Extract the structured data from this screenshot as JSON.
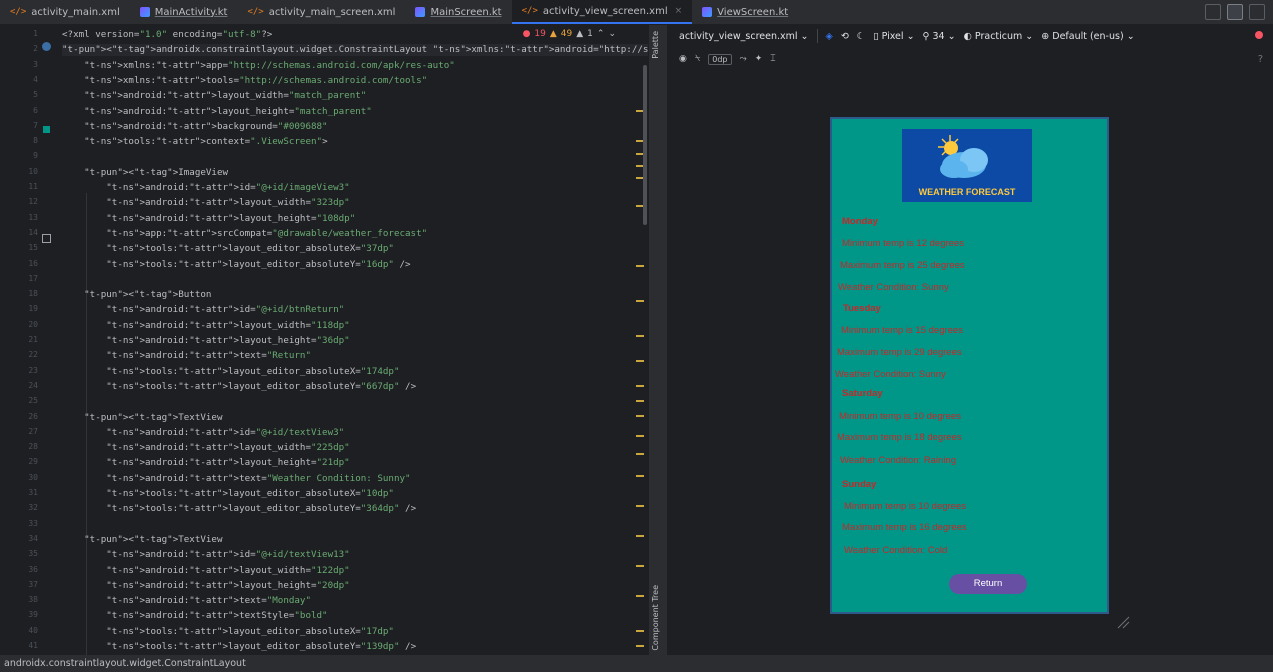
{
  "tabs": [
    {
      "label": "activity_main.xml",
      "kind": "xml",
      "active": false
    },
    {
      "label": "MainActivity.kt",
      "kind": "kt",
      "active": false
    },
    {
      "label": "activity_main_screen.xml",
      "kind": "xml",
      "active": false
    },
    {
      "label": "MainScreen.kt",
      "kind": "kt",
      "active": false
    },
    {
      "label": "activity_view_screen.xml",
      "kind": "xml",
      "active": true
    },
    {
      "label": "ViewScreen.kt",
      "kind": "kt",
      "active": false
    }
  ],
  "editor": {
    "inspections": {
      "errors": "19",
      "warnings": "49",
      "weak": "1"
    },
    "line_numbers": [
      "1",
      "2",
      "3",
      "4",
      "5",
      "6",
      "7",
      "8",
      "9",
      "10",
      "11",
      "12",
      "13",
      "14",
      "15",
      "16",
      "17",
      "18",
      "19",
      "20",
      "21",
      "22",
      "23",
      "24",
      "25",
      "26",
      "27",
      "28",
      "29",
      "30",
      "31",
      "32",
      "33",
      "34",
      "35",
      "36",
      "37",
      "38",
      "39",
      "40",
      "41"
    ],
    "lines": [
      "<?xml version=\"1.0\" encoding=\"utf-8\"?>",
      "<androidx.constraintlayout.widget.ConstraintLayout xmlns:android=\"http://schemas.android.com/apk/res/andr",
      "    xmlns:app=\"http://schemas.android.com/apk/res-auto\"",
      "    xmlns:tools=\"http://schemas.android.com/tools\"",
      "    android:layout_width=\"match_parent\"",
      "    android:layout_height=\"match_parent\"",
      "    android:background=\"#009688\"",
      "    tools:context=\".ViewScreen\">",
      "",
      "    <ImageView",
      "        android:id=\"@+id/imageView3\"",
      "        android:layout_width=\"323dp\"",
      "        android:layout_height=\"108dp\"",
      "        app:srcCompat=\"@drawable/weather_forecast\"",
      "        tools:layout_editor_absoluteX=\"37dp\"",
      "        tools:layout_editor_absoluteY=\"16dp\" />",
      "",
      "    <Button",
      "        android:id=\"@+id/btnReturn\"",
      "        android:layout_width=\"118dp\"",
      "        android:layout_height=\"36dp\"",
      "        android:text=\"Return\"",
      "        tools:layout_editor_absoluteX=\"174dp\"",
      "        tools:layout_editor_absoluteY=\"667dp\" />",
      "",
      "    <TextView",
      "        android:id=\"@+id/textView3\"",
      "        android:layout_width=\"225dp\"",
      "        android:layout_height=\"21dp\"",
      "        android:text=\"Weather Condition: Sunny\"",
      "        tools:layout_editor_absoluteX=\"10dp\"",
      "        tools:layout_editor_absoluteY=\"364dp\" />",
      "",
      "    <TextView",
      "        android:id=\"@+id/textView13\"",
      "        android:layout_width=\"122dp\"",
      "        android:layout_height=\"20dp\"",
      "        android:text=\"Monday\"",
      "        android:textStyle=\"bold\"",
      "        tools:layout_editor_absoluteX=\"17dp\"",
      "        tools:layout_editor_absoluteY=\"139dp\" />"
    ]
  },
  "sidebar": {
    "palette": "Palette",
    "component_tree": "Component Tree"
  },
  "design_toolbar": {
    "file": "activity_view_screen.xml",
    "device": "Pixel",
    "api": "34",
    "theme": "Practicum",
    "locale": "Default (en-us)",
    "margin": "0dp",
    "help": "?"
  },
  "preview": {
    "background": "#009688",
    "banner_title": "WEATHER FORECAST",
    "texts": [
      {
        "text": "Monday",
        "bold": true
      },
      {
        "text": "Minimum temp is 12 degrees",
        "bold": false
      },
      {
        "text": "Maximum temp is 25 degrees",
        "bold": false
      },
      {
        "text": "Weather Condition: Sunny",
        "bold": false
      },
      {
        "text": "Tuesday",
        "bold": true
      },
      {
        "text": "Minimum temp is 15 degrees",
        "bold": false
      },
      {
        "text": "Maximum temp is 29 degrees",
        "bold": false
      },
      {
        "text": "Weather Condition: Sunny",
        "bold": false
      },
      {
        "text": "Saturday",
        "bold": true
      },
      {
        "text": "Minimum temp is 10 degrees",
        "bold": false
      },
      {
        "text": "Maximum temp is 18 degrees",
        "bold": false
      },
      {
        "text": "Weather Condition: Raining",
        "bold": false
      },
      {
        "text": "Sunday",
        "bold": true
      },
      {
        "text": "Minimum temp is 10 degrees",
        "bold": false
      },
      {
        "text": "Maximum temp is 16 degrees",
        "bold": false
      },
      {
        "text": "Weather Condition: Cold",
        "bold": false
      }
    ],
    "return_button": "Return"
  },
  "status_bar": "androidx.constraintlayout.widget.ConstraintLayout"
}
